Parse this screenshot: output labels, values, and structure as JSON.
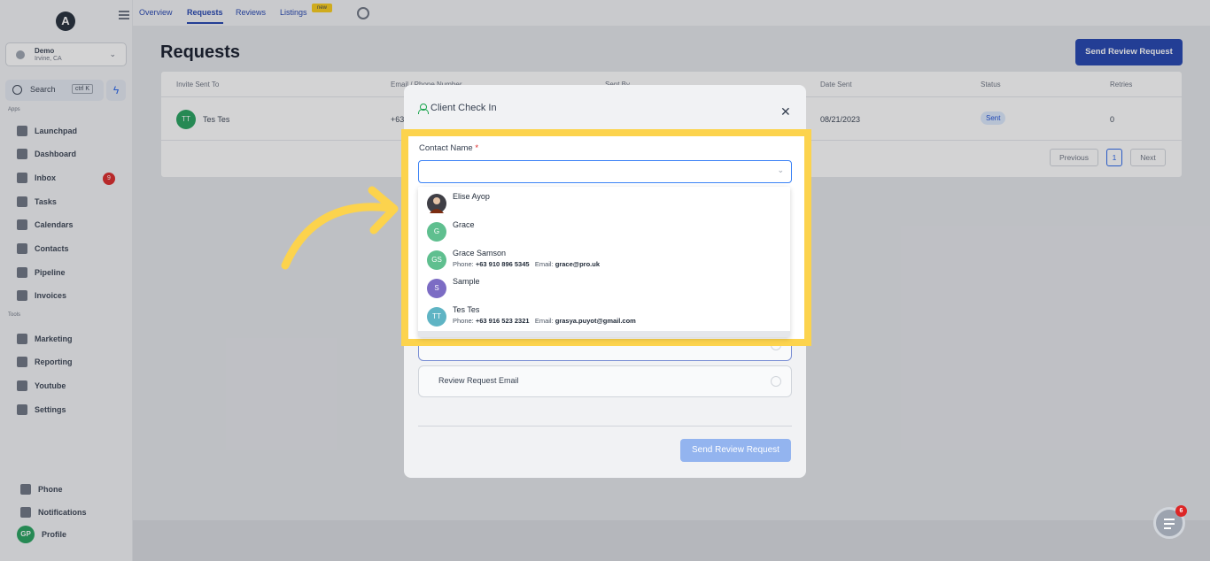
{
  "sidebar": {
    "logo": "A",
    "location": {
      "name": "Demo",
      "sub": "Irvine, CA"
    },
    "search": {
      "label": "Search",
      "shortcut": "ctrl K"
    },
    "apps_label": "Apps",
    "tools_label": "Tools",
    "apps": [
      {
        "label": "Launchpad",
        "icon": "rocket-icon"
      },
      {
        "label": "Dashboard",
        "icon": "dashboard-icon"
      },
      {
        "label": "Inbox",
        "icon": "inbox-icon",
        "badge": "9"
      },
      {
        "label": "Tasks",
        "icon": "tasks-icon"
      },
      {
        "label": "Calendars",
        "icon": "calendar-icon"
      },
      {
        "label": "Contacts",
        "icon": "contacts-icon"
      },
      {
        "label": "Pipeline",
        "icon": "pipeline-icon"
      },
      {
        "label": "Invoices",
        "icon": "invoice-icon"
      }
    ],
    "tools": [
      {
        "label": "Marketing",
        "icon": "marketing-icon"
      },
      {
        "label": "Reporting",
        "icon": "reporting-icon"
      },
      {
        "label": "Youtube",
        "icon": "youtube-icon"
      },
      {
        "label": "Settings",
        "icon": "settings-icon"
      }
    ],
    "bottom": {
      "phone": "Phone",
      "notifications": "Notifications",
      "profile": "Profile",
      "profile_initials": "GP"
    }
  },
  "topnav": {
    "tabs": [
      "Overview",
      "Requests",
      "Reviews",
      "Listings"
    ],
    "new_badge": "new"
  },
  "main": {
    "title": "Requests",
    "send_button": "Send Review Request",
    "table": {
      "headers": [
        "Invite Sent To",
        "Email / Phone Number",
        "Sent By",
        "Date Sent",
        "Status",
        "Retries"
      ],
      "row": {
        "initials": "TT",
        "name": "Tes Tes",
        "contact": "+63",
        "date": "08/21/2023",
        "status": "Sent",
        "retries": "0"
      }
    },
    "pagination": {
      "previous": "Previous",
      "current": "1",
      "next": "Next"
    }
  },
  "modal": {
    "title": "Client Check In",
    "contact_label": "Contact Name",
    "required_mark": "*",
    "option_label": "Review Request Email",
    "send_button": "Send Review Request",
    "contacts": [
      {
        "name": "Elise Ayop",
        "initials": "",
        "color": "#3f3f46",
        "details": null
      },
      {
        "name": "Grace",
        "initials": "G",
        "color": "#5fbf8f",
        "details": null
      },
      {
        "name": "Grace Samson",
        "initials": "GS",
        "color": "#5fbf8f",
        "phone_label": "Phone:",
        "phone": "+63 910 896 5345",
        "email_label": "Email:",
        "email": "grace@pro.uk"
      },
      {
        "name": "Sample",
        "initials": "S",
        "color": "#7c6cc4",
        "details": null
      },
      {
        "name": "Tes Tes",
        "initials": "TT",
        "color": "#5fb4c4",
        "phone_label": "Phone:",
        "phone": "+63 916 523 2321",
        "email_label": "Email:",
        "email": "grasya.puyot@gmail.com"
      }
    ]
  },
  "chat": {
    "badge": "6"
  },
  "colors": {
    "primary": "#1e40af",
    "highlight": "#fcd34d",
    "arrow": "#fcd34d",
    "danger": "#dc2626"
  }
}
